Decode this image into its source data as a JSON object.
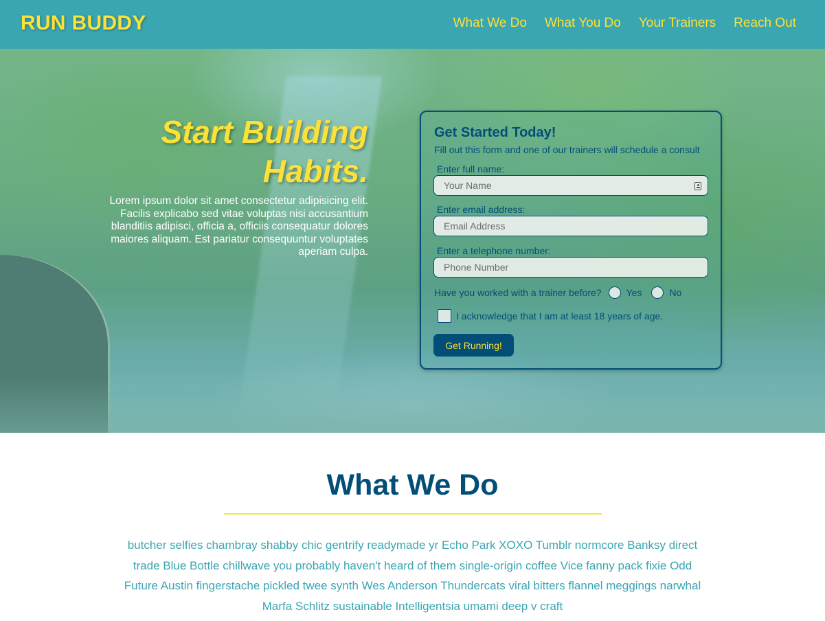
{
  "header": {
    "logo": "RUN BUDDY",
    "nav": [
      "What We Do",
      "What You Do",
      "Your Trainers",
      "Reach Out"
    ]
  },
  "hero": {
    "title_line1": "Start Building",
    "title_line2": "Habits.",
    "text": "Lorem ipsum dolor sit amet consectetur adipisicing elit. Facilis explicabo sed vitae voluptas nisi accusantium blanditiis adipisci, officia a, officiis consequatur dolores maiores aliquam. Est pariatur consequuntur voluptates aperiam culpa."
  },
  "form": {
    "title": "Get Started Today!",
    "subtitle": "Fill out this form and one of our trainers will schedule a consult",
    "name_label": "Enter full name:",
    "name_placeholder": "Your Name",
    "email_label": "Enter email address:",
    "email_placeholder": "Email Address",
    "phone_label": "Enter a telephone number:",
    "phone_placeholder": "Phone Number",
    "trainer_question": "Have you worked with a trainer before?",
    "yes_label": "Yes",
    "no_label": "No",
    "age_ack": "I acknowledge that I am at least 18 years of age.",
    "submit_label": "Get Running!"
  },
  "what_we_do": {
    "title": "What We Do",
    "text": "butcher selfies chambray shabby chic gentrify readymade yr Echo Park XOXO Tumblr normcore Banksy direct trade Blue Bottle chillwave you probably haven't heard of them single-origin coffee Vice fanny pack fixie Odd Future Austin fingerstache pickled twee synth Wes Anderson Thundercats viral bitters flannel meggings narwhal Marfa Schlitz sustainable Intelligentsia umami deep v craft"
  },
  "colors": {
    "header_bg": "#39a6b2",
    "accent_yellow": "#fce138",
    "dark_blue": "#024e76"
  }
}
